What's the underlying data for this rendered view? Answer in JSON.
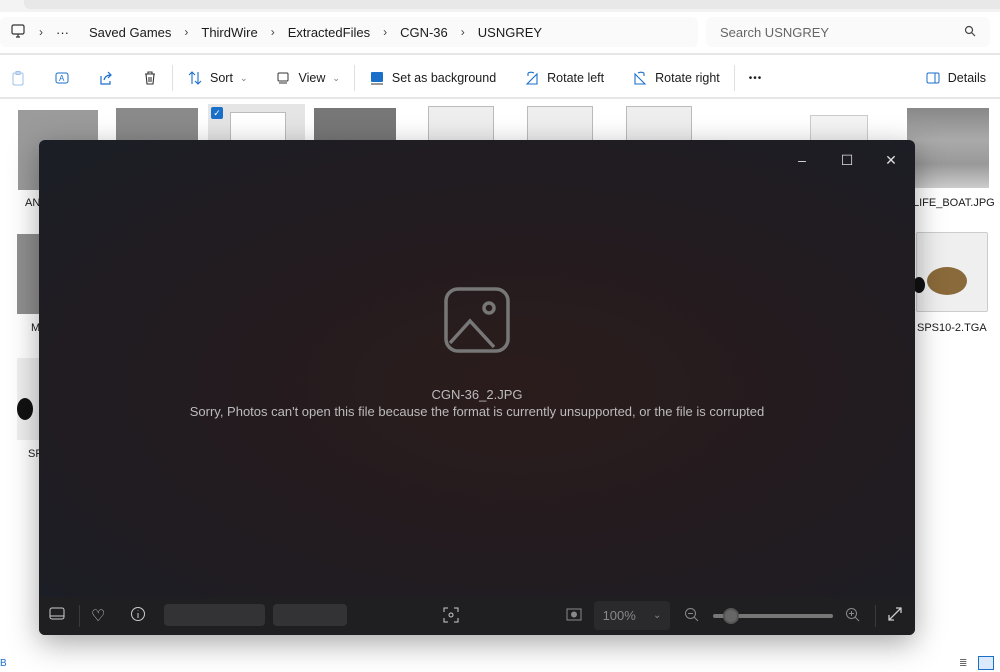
{
  "breadcrumb": {
    "icon": "computer-icon",
    "overflow": "···",
    "items": [
      "Saved Games",
      "ThirdWire",
      "ExtractedFiles",
      "CGN-36",
      "USNGREY"
    ]
  },
  "search": {
    "placeholder": "Search USNGREY"
  },
  "toolbar": {
    "sort": "Sort",
    "view": "View",
    "set_background": "Set as background",
    "rotate_left": "Rotate left",
    "rotate_right": "Rotate right",
    "more": "•••",
    "details": "Details"
  },
  "files": {
    "visible_labels": [
      "AN",
      "LIFE_BOAT.JPG",
      "M",
      "SPS10-2.TGA",
      "SP"
    ]
  },
  "viewer": {
    "file_name": "CGN-36_2.JPG",
    "error_message": "Sorry, Photos can't open this file because the format is currently unsupported, or the file is corrupted",
    "zoom_level": "100%",
    "zoom_slider_fraction": 0.15
  },
  "statusbar": {
    "left": "B"
  }
}
